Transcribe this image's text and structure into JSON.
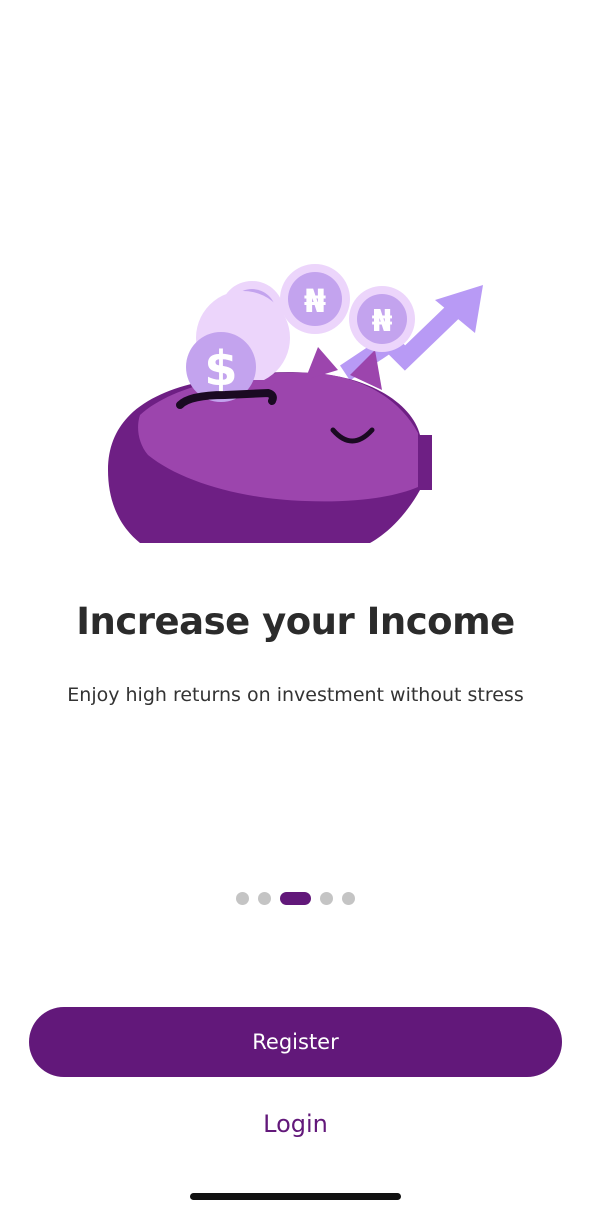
{
  "onboarding": {
    "title": "Increase your Income",
    "subtitle": "Enjoy high returns on investment without stress",
    "current_page": 3,
    "total_pages": 5
  },
  "actions": {
    "register_label": "Register",
    "login_label": "Login"
  },
  "illustration": {
    "coins": [
      "$",
      "$",
      "₦",
      "₦"
    ]
  },
  "colors": {
    "brand": "#62187a",
    "dot_inactive": "#c4c4c4"
  }
}
